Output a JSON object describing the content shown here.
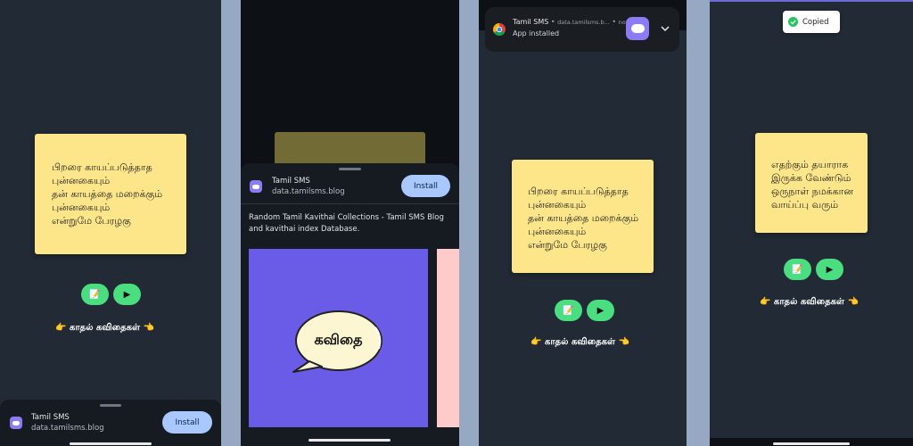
{
  "poem_long": {
    "lines": [
      "பிறரை காயப்படுத்தாத",
      "புன்னகையும்",
      "தன் காயத்தை மறைக்கும்",
      "புன்னகையும்",
      "என்றுமே பேரழகு"
    ]
  },
  "poem_short": {
    "lines": [
      "எதற்கும் தயாராக",
      "இருக்க வேண்டும்",
      "ஒருநாள் நமக்கான",
      "வாய்ப்பு வரும்"
    ]
  },
  "buttons": {
    "copy_icon": "📝",
    "play_icon": "▶"
  },
  "link_label": "👉 காதல் கவிதைகள் 👈",
  "install_sheet": {
    "app_name": "Tamil SMS",
    "app_url": "data.tamilsms.blog",
    "install_label": "Install",
    "description": "Random Tamil Kavithai Collections - Tamil SMS Blog and kavithai index Database.",
    "hero_word": "கவிதை"
  },
  "notification": {
    "app_name": "Tamil SMS",
    "source": "data.tamilsms.b...",
    "time": "now",
    "dot": "•",
    "message": "App installed",
    "expand_icon": "chevron-down-icon"
  },
  "toast": {
    "label": "Copied",
    "icon": "check-circle-icon"
  },
  "colors": {
    "background": "#222a35",
    "note": "#fde68a",
    "button": "#4ade80",
    "install": "#a8c8ff",
    "brand": "#6b5ce7",
    "accent": "#8b7cf6"
  }
}
